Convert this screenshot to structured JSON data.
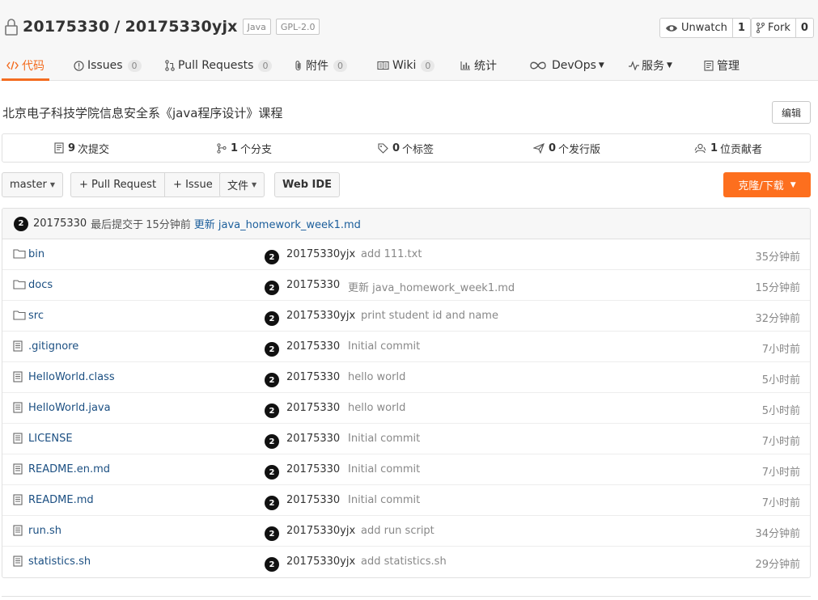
{
  "repo": {
    "owner": "20175330",
    "separator": "/",
    "name": "20175330yjx",
    "tags": [
      "Java",
      "GPL-2.0"
    ]
  },
  "actions": {
    "watch_label": "Unwatch",
    "watch_count": "1",
    "fork_label": "Fork",
    "fork_count": "0"
  },
  "nav": {
    "code": "代码",
    "issues": "Issues",
    "issues_count": "0",
    "pulls": "Pull Requests",
    "pulls_count": "0",
    "attachments": "附件",
    "attachments_count": "0",
    "wiki": "Wiki",
    "wiki_count": "0",
    "stats": "统计",
    "devops": "DevOps",
    "services": "服务",
    "manage": "管理"
  },
  "description": "北京电子科技学院信息安全系《java程序设计》课程",
  "edit_label": "编辑",
  "stats": {
    "commits_num": "9",
    "commits_label": "次提交",
    "branches_num": "1",
    "branches_label": "个分支",
    "tags_num": "0",
    "tags_label": "个标签",
    "releases_num": "0",
    "releases_label": "个发行版",
    "contributors_num": "1",
    "contributors_label": "位贡献者"
  },
  "toolbar": {
    "branch": "master",
    "pull_request": "+ Pull Request",
    "issue": "+ Issue",
    "files": "文件",
    "web_ide": "Web IDE",
    "clone": "克隆/下载"
  },
  "last_commit": {
    "avatar": "2",
    "author": "20175330",
    "prefix": "最后提交于",
    "time": "15分钟前",
    "message": "更新 java_homework_week1.md"
  },
  "files": [
    {
      "name": "bin",
      "type": "folder",
      "avatar": "2",
      "author": "20175330yjx",
      "message": "add 111.txt",
      "time": "35分钟前"
    },
    {
      "name": "docs",
      "type": "folder",
      "avatar": "2",
      "author": "20175330",
      "message": "更新 java_homework_week1.md",
      "time": "15分钟前"
    },
    {
      "name": "src",
      "type": "folder",
      "avatar": "2",
      "author": "20175330yjx",
      "message": "print student id and name",
      "time": "32分钟前"
    },
    {
      "name": ".gitignore",
      "type": "file",
      "avatar": "2",
      "author": "20175330",
      "message": "Initial commit",
      "time": "7小时前"
    },
    {
      "name": "HelloWorld.class",
      "type": "file",
      "avatar": "2",
      "author": "20175330",
      "message": "hello world",
      "time": "5小时前"
    },
    {
      "name": "HelloWorld.java",
      "type": "file",
      "avatar": "2",
      "author": "20175330",
      "message": "hello world",
      "time": "5小时前"
    },
    {
      "name": "LICENSE",
      "type": "file",
      "avatar": "2",
      "author": "20175330",
      "message": "Initial commit",
      "time": "7小时前"
    },
    {
      "name": "README.en.md",
      "type": "file",
      "avatar": "2",
      "author": "20175330",
      "message": "Initial commit",
      "time": "7小时前"
    },
    {
      "name": "README.md",
      "type": "file",
      "avatar": "2",
      "author": "20175330",
      "message": "Initial commit",
      "time": "7小时前"
    },
    {
      "name": "run.sh",
      "type": "file",
      "avatar": "2",
      "author": "20175330yjx",
      "message": "add run script",
      "time": "34分钟前"
    },
    {
      "name": "statistics.sh",
      "type": "file",
      "avatar": "2",
      "author": "20175330yjx",
      "message": "add statistics.sh",
      "time": "29分钟前"
    }
  ],
  "colors": {
    "accent": "#f36c20",
    "clone_bg": "#fd6f1e",
    "link": "#1b4f82"
  },
  "icons": {
    "lock": "lock-icon",
    "eye": "eye-icon",
    "fork": "fork-icon",
    "code": "code-icon",
    "issue": "issue-icon",
    "pull": "pull-request-icon",
    "attachment": "paperclip-icon",
    "wiki": "book-icon",
    "stats": "bar-chart-icon",
    "devops": "infinity-icon",
    "services": "pulse-icon",
    "manage": "clipboard-icon",
    "folder": "folder-icon",
    "file": "file-icon"
  }
}
